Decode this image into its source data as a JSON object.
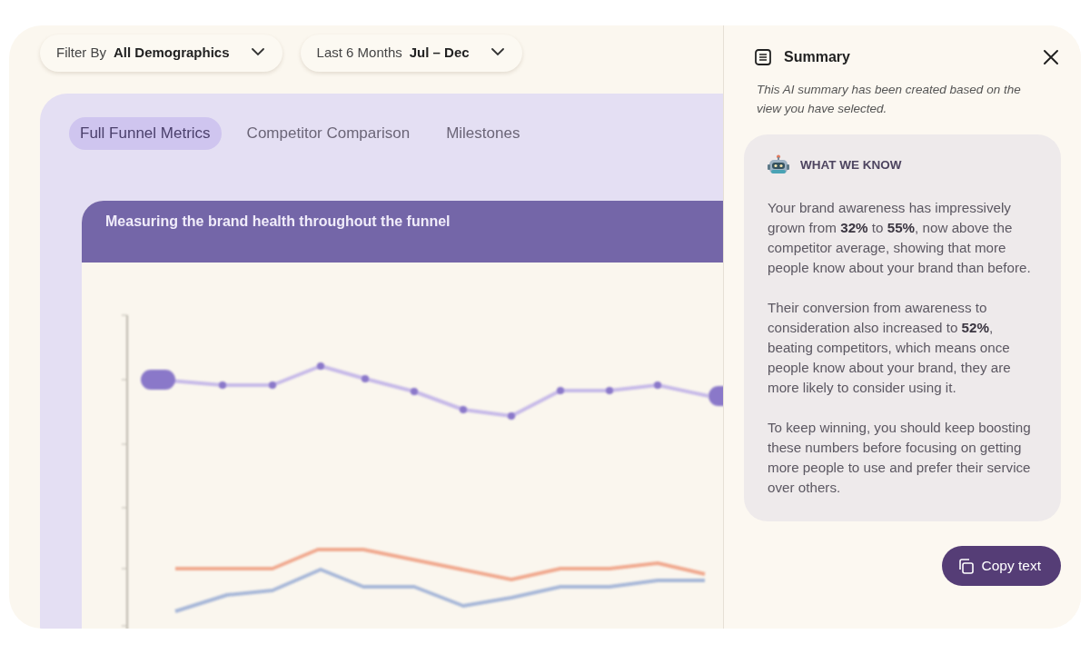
{
  "filters": [
    {
      "label": "Filter By",
      "value": "All Demographics"
    },
    {
      "label": "Last 6 Months",
      "value": "Jul – Dec"
    }
  ],
  "tabs": [
    {
      "label": "Full Funnel Metrics",
      "selected": true
    },
    {
      "label": "Competitor Comparison",
      "selected": false
    },
    {
      "label": "Milestones",
      "selected": false
    }
  ],
  "chart_card": {
    "title": "Measuring the brand health throughout the funnel"
  },
  "summary": {
    "title": "Summary",
    "note": "This AI summary has been created based on the view you have selected.",
    "section_heading": "WHAT WE KNOW",
    "paragraphs": [
      "Your brand awareness has impressively grown from **32%** to **55%**, now above the competitor average, showing that more people know about your brand than before.",
      "Their conversion from awareness to consideration also increased to **52%**, beating competitors, which means once people know about your brand, they are more likely to consider using it.",
      "To keep winning, you should keep boosting these numbers before focusing on getting more people to use and prefer their service over others."
    ],
    "copy_button": "Copy text"
  }
}
